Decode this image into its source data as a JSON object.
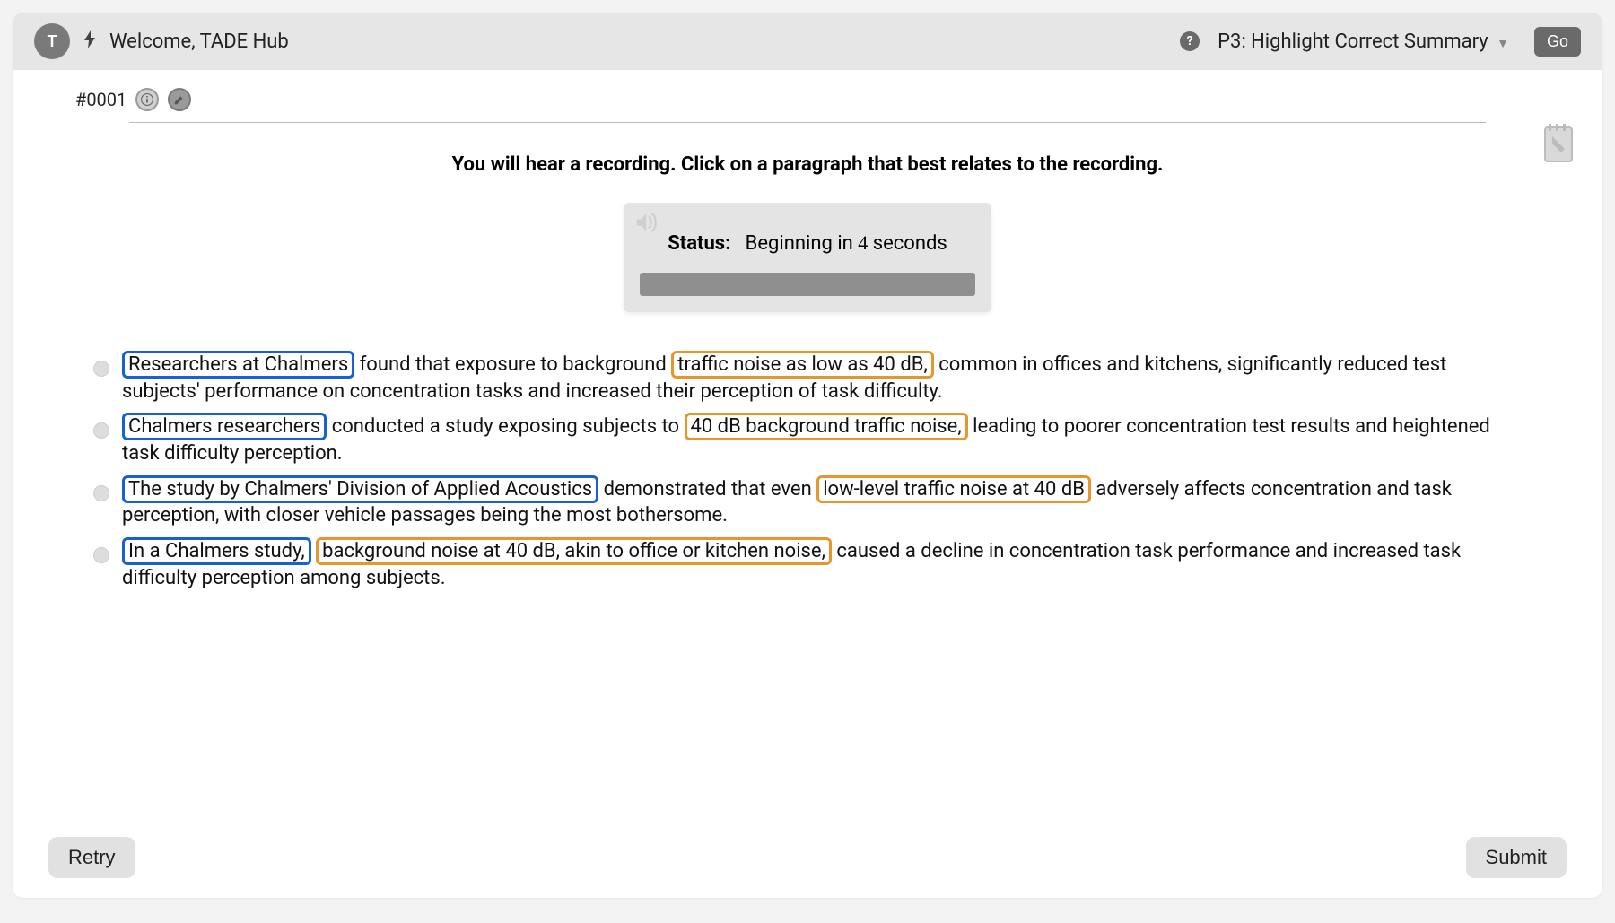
{
  "header": {
    "avatar_initial": "T",
    "welcome": "Welcome, TADE Hub",
    "task_label": "P3: Highlight Correct Summary",
    "go_label": "Go"
  },
  "item": {
    "id": "#0001"
  },
  "instruction": "You will hear a recording. Click on a paragraph that best relates to the recording.",
  "audio": {
    "status_label": "Status:",
    "status_prefix": "Beginning in",
    "status_count": "4",
    "status_suffix": "seconds"
  },
  "options": [
    {
      "segments": [
        {
          "t": "Researchers at Chalmers",
          "hl": "blue"
        },
        {
          "t": " found that exposure to background "
        },
        {
          "t": "traffic noise as low as 40 dB,",
          "hl": "orange"
        },
        {
          "t": " common in offices and kitchens, significantly reduced test subjects' performance on concentration tasks and increased their perception of task difficulty."
        }
      ]
    },
    {
      "segments": [
        {
          "t": "Chalmers researchers",
          "hl": "blue"
        },
        {
          "t": " conducted a study exposing subjects to "
        },
        {
          "t": "40 dB background traffic noise,",
          "hl": "orange"
        },
        {
          "t": " leading to poorer concentration test results and heightened task difficulty perception."
        }
      ]
    },
    {
      "segments": [
        {
          "t": "The study by Chalmers' Division of Applied Acoustics",
          "hl": "blue"
        },
        {
          "t": " demonstrated that even "
        },
        {
          "t": "low-level traffic noise at 40 dB",
          "hl": "orange"
        },
        {
          "t": " adversely affects concentration and task perception, with closer vehicle passages being the most bothersome."
        }
      ]
    },
    {
      "segments": [
        {
          "t": "In a Chalmers study,",
          "hl": "blue"
        },
        {
          "t": " "
        },
        {
          "t": "background noise at 40 dB, akin to office or kitchen noise,",
          "hl": "orange"
        },
        {
          "t": " caused a decline in concentration task performance and increased task difficulty perception among subjects."
        }
      ]
    }
  ],
  "footer": {
    "retry": "Retry",
    "submit": "Submit"
  }
}
